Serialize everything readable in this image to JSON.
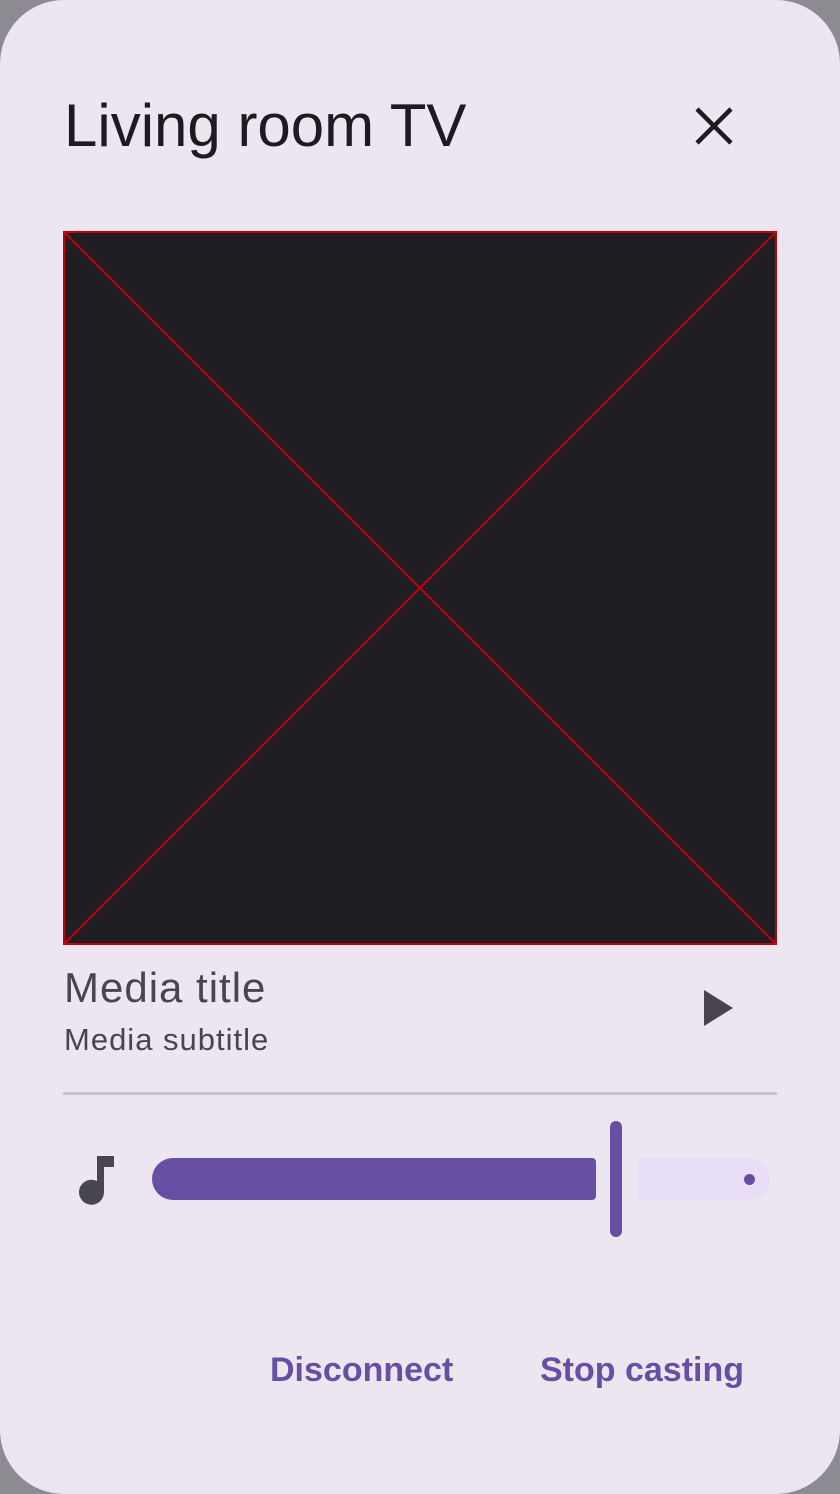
{
  "dialog": {
    "title": "Living room TV",
    "close_icon": "close-icon"
  },
  "media": {
    "artwork": "placeholder-image",
    "title": "Media title",
    "subtitle": "Media subtitle",
    "play_icon": "play-icon"
  },
  "volume": {
    "icon": "music-note-icon",
    "level_fraction": 0.74
  },
  "actions": {
    "disconnect_label": "Disconnect",
    "stop_casting_label": "Stop casting"
  },
  "colors": {
    "surface": "#ece6f0",
    "primary": "#6750a4",
    "secondary_container": "#e8def8",
    "on_surface": "#1d1b20",
    "on_surface_variant": "#49454f",
    "placeholder_stroke": "#c4000f"
  }
}
